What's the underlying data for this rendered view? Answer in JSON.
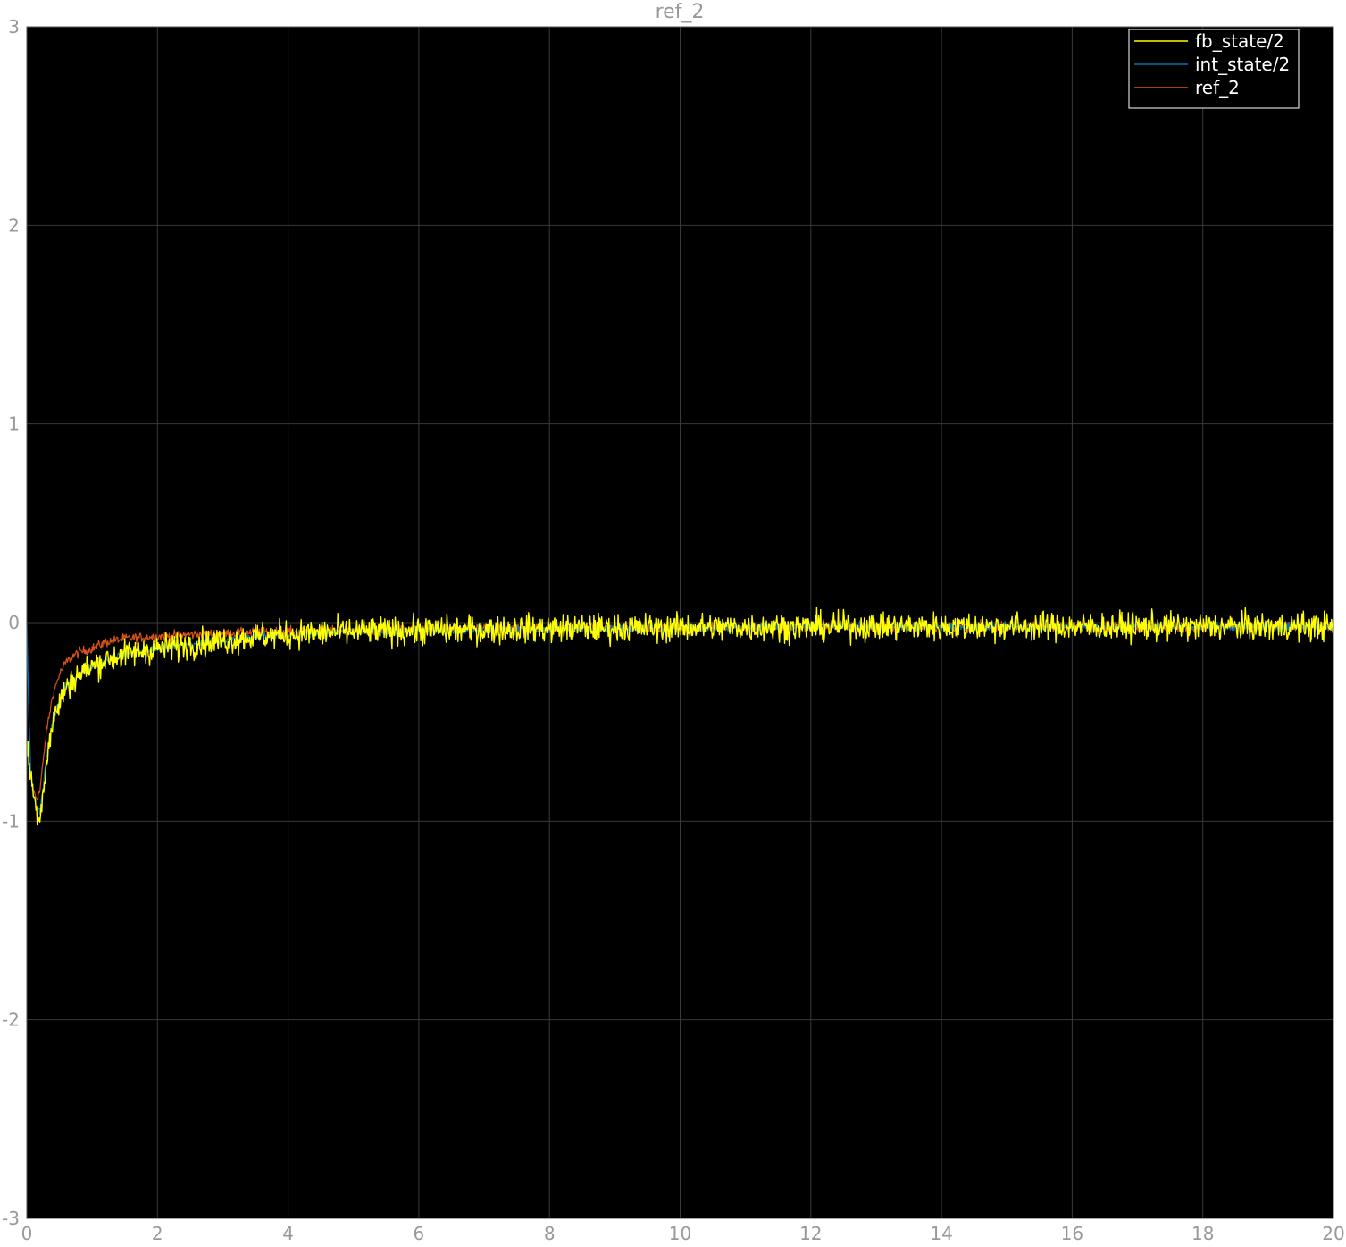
{
  "chart_data": {
    "type": "line",
    "title": "ref_2",
    "xlim": [
      0,
      20
    ],
    "ylim": [
      -3,
      3
    ],
    "x_ticks": [
      0,
      2,
      4,
      6,
      8,
      10,
      12,
      14,
      16,
      18,
      20
    ],
    "y_ticks": [
      -3,
      -2,
      -1,
      0,
      1,
      2,
      3
    ],
    "x_tick_labels": [
      "0",
      "2",
      "4",
      "6",
      "8",
      "10",
      "12",
      "14",
      "16",
      "18",
      "20"
    ],
    "y_tick_labels": [
      "-3",
      "-2",
      "-1",
      "0",
      "1",
      "2",
      "3"
    ],
    "grid": true,
    "legend_position": "top-right",
    "background_color": "#000000",
    "grid_color": "#3a3a3a",
    "series": [
      {
        "name": "fb_state/2",
        "color": "#ffff00",
        "x": [
          0,
          0.05,
          0.1,
          0.15,
          0.2,
          0.25,
          0.3,
          0.4,
          0.5,
          0.6,
          0.7,
          0.8,
          1.0,
          1.2,
          1.5,
          2.0,
          2.5,
          3.0,
          3.5,
          4.0,
          5.0,
          6.0,
          7.0,
          8.0,
          10.0,
          12.0,
          14.0,
          16.0,
          18.0,
          20.0
        ],
        "y": [
          -0.6,
          -0.75,
          -0.85,
          -0.95,
          -0.98,
          -0.85,
          -0.7,
          -0.5,
          -0.4,
          -0.33,
          -0.29,
          -0.26,
          -0.22,
          -0.19,
          -0.16,
          -0.13,
          -0.11,
          -0.09,
          -0.07,
          -0.06,
          -0.045,
          -0.04,
          -0.035,
          -0.03,
          -0.025,
          -0.02,
          -0.02,
          -0.02,
          -0.02,
          -0.02
        ],
        "noise": 0.035
      },
      {
        "name": "int_state/2",
        "color": "#0072bd",
        "x": [
          0,
          0.03,
          0.06,
          0.1,
          0.15,
          0.2,
          0.25,
          0.3,
          0.4,
          0.5,
          0.6,
          0.7,
          0.8,
          1.0,
          1.2,
          1.5,
          2.0,
          2.5,
          3.0,
          3.5,
          4.0,
          5.0,
          6.0,
          7.0,
          8.0,
          10.0,
          12.0,
          14.0,
          16.0,
          18.0,
          20.0
        ],
        "y": [
          0.0,
          -0.45,
          -0.75,
          -0.88,
          -0.93,
          -0.95,
          -0.83,
          -0.68,
          -0.49,
          -0.39,
          -0.33,
          -0.29,
          -0.26,
          -0.22,
          -0.19,
          -0.16,
          -0.13,
          -0.11,
          -0.09,
          -0.07,
          -0.06,
          -0.045,
          -0.04,
          -0.035,
          -0.03,
          -0.025,
          -0.02,
          -0.02,
          -0.02,
          -0.02,
          -0.02
        ],
        "noise": 0.01
      },
      {
        "name": "ref_2",
        "color": "#d95319",
        "x": [
          0,
          0.05,
          0.1,
          0.15,
          0.2,
          0.25,
          0.3,
          0.4,
          0.5,
          0.6,
          0.7,
          0.8,
          1.0,
          1.2,
          1.5,
          2.0,
          2.5,
          3.0,
          3.5,
          4.0,
          5.0,
          6.0,
          7.0,
          8.0,
          10.0,
          12.0,
          14.0,
          16.0,
          18.0,
          20.0
        ],
        "y": [
          -0.6,
          -0.75,
          -0.85,
          -0.88,
          -0.85,
          -0.7,
          -0.55,
          -0.36,
          -0.26,
          -0.2,
          -0.17,
          -0.15,
          -0.13,
          -0.1,
          -0.08,
          -0.07,
          -0.06,
          -0.055,
          -0.05,
          -0.045,
          -0.04,
          -0.035,
          -0.03,
          -0.03,
          -0.025,
          -0.02,
          -0.02,
          -0.02,
          -0.02,
          -0.02
        ],
        "noise": 0.012
      }
    ]
  }
}
